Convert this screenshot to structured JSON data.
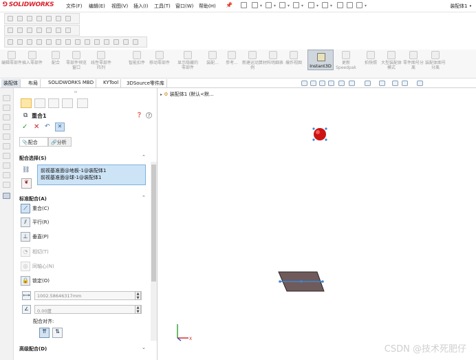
{
  "app": {
    "logo_text": "SOLIDWORKS",
    "menus": [
      "文件(F)",
      "编辑(E)",
      "视图(V)",
      "插入(I)",
      "工具(T)",
      "窗口(W)",
      "帮助(H)"
    ],
    "document_title": "装配体1 •"
  },
  "command_manager": {
    "buttons": [
      "编辑零部件",
      "插入零部件",
      "配合",
      "零部件预览窗口",
      "线性零部件阵列",
      "智能扣件",
      "移动零部件",
      "显示隐藏的零部件",
      "装配...",
      "参考...",
      "新建运动算例",
      "材料明细表",
      "爆炸视图",
      "Instant3D",
      "更新Speedpak",
      "拍快照",
      "大型装配体模式",
      "零件图号分离",
      "装配体图号分离"
    ],
    "active_button": "Instant3D"
  },
  "tabs": [
    "装配体",
    "布局",
    "SOLIDWORKS MBD",
    "KYTool",
    "3DSource零件库"
  ],
  "active_tab": "装配体",
  "property_manager": {
    "title": "重合1",
    "help_icons": [
      "❓",
      "?"
    ],
    "sub_tabs": [
      {
        "label": "配合"
      },
      {
        "label": "分析"
      }
    ],
    "active_sub_tab": "配合",
    "mate_selection": {
      "header": "配合选择(S)",
      "items": [
        "前视基准面@地板-1@装配体1",
        "前视基准面@球-1@装配体1"
      ]
    },
    "standard_mates": {
      "header": "标准配合(A)",
      "items": [
        {
          "label": "重合(C)",
          "enabled": true,
          "active": true
        },
        {
          "label": "平行(R)",
          "enabled": true
        },
        {
          "label": "垂直(P)",
          "enabled": true
        },
        {
          "label": "相切(T)",
          "enabled": false
        },
        {
          "label": "同轴心(N)",
          "enabled": false
        },
        {
          "label": "锁定(O)",
          "enabled": true
        }
      ],
      "distance_value": "1002.58646317mm",
      "angle_value": "0.00度",
      "alignment_label": "配合对齐:"
    },
    "advanced_header": "高级配合(D)"
  },
  "viewport": {
    "tree_label": "装配体1 (默认<默..."
  },
  "watermark": "CSDN @技术死肥仔",
  "colors": {
    "accent": "#3a86d4",
    "selection_fill": "#cde4f7",
    "ball": "#cc1414",
    "plate": "#6f5b5b"
  }
}
